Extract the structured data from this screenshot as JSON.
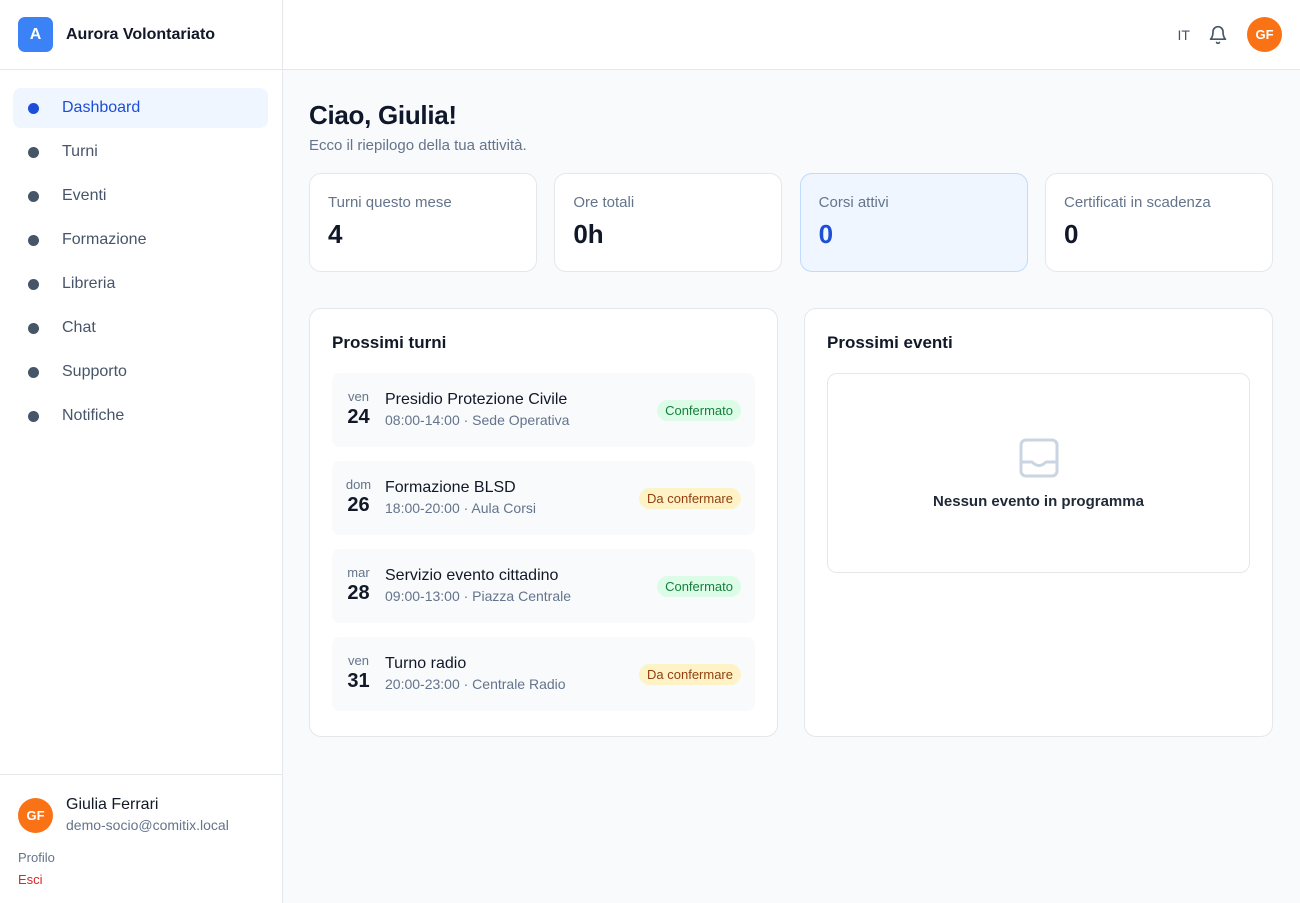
{
  "brand": {
    "logo_letter": "A",
    "name": "Aurora Volontariato",
    "accent": "#3b82f6"
  },
  "nav": {
    "items": [
      {
        "label": "Dashboard",
        "icon": "dot-icon",
        "active": true
      },
      {
        "label": "Turni",
        "icon": "dot-icon"
      },
      {
        "label": "Eventi",
        "icon": "dot-icon"
      },
      {
        "label": "Formazione",
        "icon": "dot-icon"
      },
      {
        "label": "Libreria",
        "icon": "dot-icon"
      },
      {
        "label": "Chat",
        "icon": "dot-icon"
      },
      {
        "label": "Supporto",
        "icon": "dot-icon"
      },
      {
        "label": "Notifiche",
        "icon": "dot-icon"
      }
    ]
  },
  "user": {
    "initials": "GF",
    "name": "Giulia Ferrari",
    "email": "demo-socio@comitix.local",
    "profile_label": "Profilo",
    "logout_label": "Esci",
    "avatar_color": "#f97316"
  },
  "topbar": {
    "language": "IT",
    "bell_icon": "bell-icon",
    "avatar_initials": "GF"
  },
  "header": {
    "greeting": "Ciao, Giulia!",
    "subtitle": "Ecco il riepilogo della tua attività."
  },
  "stats": [
    {
      "label": "Turni questo mese",
      "value": "4"
    },
    {
      "label": "Ore totali",
      "value": "0h"
    },
    {
      "label": "Corsi attivi",
      "value": "0",
      "highlight": true
    },
    {
      "label": "Certificati in scadenza",
      "value": "0"
    }
  ],
  "shifts": {
    "title": "Prossimi turni",
    "items": [
      {
        "dow": "ven",
        "day": "24",
        "title": "Presidio Protezione Civile",
        "meta": "08:00-14:00 · Sede Operativa",
        "status": "Confermato",
        "status_type": "ok"
      },
      {
        "dow": "dom",
        "day": "26",
        "title": "Formazione BLSD",
        "meta": "18:00-20:00 · Aula Corsi",
        "status": "Da confermare",
        "status_type": "pending"
      },
      {
        "dow": "mar",
        "day": "28",
        "title": "Servizio evento cittadino",
        "meta": "09:00-13:00 · Piazza Centrale",
        "status": "Confermato",
        "status_type": "ok"
      },
      {
        "dow": "ven",
        "day": "31",
        "title": "Turno radio",
        "meta": "20:00-23:00 · Centrale Radio",
        "status": "Da confermare",
        "status_type": "pending"
      }
    ]
  },
  "events": {
    "title": "Prossimi eventi",
    "empty_icon": "inbox-icon",
    "empty_text": "Nessun evento in programma"
  }
}
